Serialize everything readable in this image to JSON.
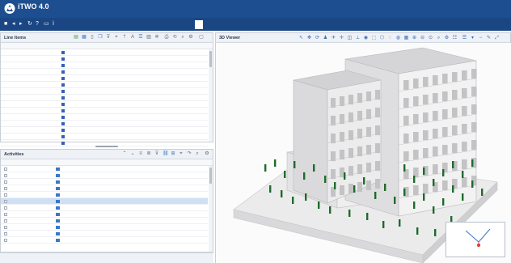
{
  "header": {
    "product": "iTWO 4.0",
    "subtitle": "",
    "right_line1": "",
    "right_line2": ""
  },
  "nav": {
    "icons": [
      "save-icon",
      "arrow-left-icon",
      "arrow-right-icon",
      "refresh-icon",
      "help-icon",
      "desktop-icon",
      "info-icon"
    ],
    "tabs": [
      {
        "label": "",
        "active": false
      },
      {
        "label": "",
        "active": false
      },
      {
        "label": "",
        "active": false
      },
      {
        "label": "",
        "active": true
      },
      {
        "label": "",
        "active": false
      }
    ]
  },
  "line_items": {
    "title": "Line Items",
    "columns": [
      "",
      "",
      "",
      "",
      ""
    ],
    "rows": [
      {
        "c": [
          "",
          "",
          "",
          "",
          ""
        ],
        "color": "#3560b8"
      },
      {
        "c": [
          "",
          "",
          "",
          "",
          ""
        ],
        "color": "#3560b8"
      },
      {
        "c": [
          "",
          "",
          "",
          "",
          ""
        ],
        "color": "#3560b8"
      },
      {
        "c": [
          "",
          "",
          "",
          "",
          ""
        ],
        "color": "#3560b8"
      },
      {
        "c": [
          "",
          "",
          "",
          "",
          ""
        ],
        "color": "#3560b8"
      },
      {
        "c": [
          "",
          "",
          "",
          "",
          ""
        ],
        "color": "#3560b8"
      },
      {
        "c": [
          "",
          "",
          "",
          "",
          ""
        ],
        "color": "#3560b8"
      },
      {
        "c": [
          "",
          "",
          "",
          "",
          ""
        ],
        "color": "#3560b8"
      },
      {
        "c": [
          "",
          "",
          "",
          "",
          ""
        ],
        "color": "#3560b8"
      },
      {
        "c": [
          "",
          "",
          "",
          "",
          ""
        ],
        "color": "#3560b8"
      },
      {
        "c": [
          "",
          "",
          "",
          "",
          ""
        ],
        "color": "#3560b8"
      },
      {
        "c": [
          "",
          "",
          "",
          "",
          ""
        ],
        "color": "#3560b8"
      },
      {
        "c": [
          "",
          "",
          "",
          "",
          ""
        ],
        "color": "#3560b8"
      },
      {
        "c": [
          "",
          "",
          "",
          "",
          ""
        ],
        "color": "#3560b8"
      },
      {
        "c": [
          "",
          "",
          "",
          "",
          ""
        ],
        "color": "#3560b8"
      }
    ]
  },
  "activities": {
    "title": "Activities",
    "columns": [
      "",
      "",
      "",
      "",
      "",
      ""
    ],
    "rows": [
      {
        "c": [
          "",
          "",
          "",
          "",
          ""
        ],
        "selected": false
      },
      {
        "c": [
          "",
          "",
          "",
          "",
          ""
        ],
        "selected": false
      },
      {
        "c": [
          "",
          "",
          "",
          "",
          ""
        ],
        "selected": false
      },
      {
        "c": [
          "",
          "",
          "",
          "",
          ""
        ],
        "selected": false
      },
      {
        "c": [
          "",
          "",
          "",
          "",
          ""
        ],
        "selected": false
      },
      {
        "c": [
          "",
          "",
          "",
          "",
          ""
        ],
        "selected": true
      },
      {
        "c": [
          "",
          "",
          "",
          "",
          ""
        ],
        "selected": false
      },
      {
        "c": [
          "",
          "",
          "",
          "",
          ""
        ],
        "selected": false
      },
      {
        "c": [
          "",
          "",
          "",
          "",
          ""
        ],
        "selected": false
      },
      {
        "c": [
          "",
          "",
          "",
          "",
          ""
        ],
        "selected": false
      },
      {
        "c": [
          "",
          "",
          "",
          "",
          ""
        ],
        "selected": false
      },
      {
        "c": [
          "",
          "",
          "",
          "",
          ""
        ],
        "selected": false
      }
    ],
    "status_links": [
      "",
      "",
      "",
      ""
    ]
  },
  "viewer": {
    "title": "3D Viewer",
    "annotation_line1": "",
    "annotation_line2": "",
    "minimap_label": "",
    "minimap_sublabel": ""
  },
  "colors": {
    "header_bg": "#1d4e8f",
    "accent": "#3a78c8",
    "highlight": "#1f6b2a",
    "minimap_marker": "#e04040"
  }
}
